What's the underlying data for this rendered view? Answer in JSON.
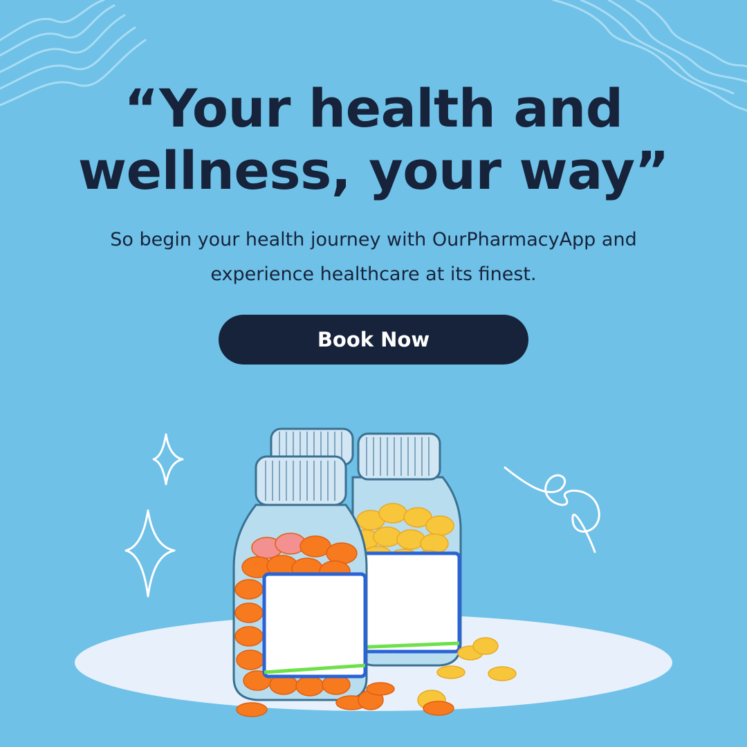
{
  "promo": {
    "headline_line1": "“Your health and",
    "headline_line2": "wellness, your way”",
    "subtext_line1": "So begin your health journey with OurPharmacyApp and",
    "subtext_line2": "experience healthcare at its finest.",
    "cta_label": "Book Now"
  },
  "colors": {
    "background": "#6fc1e8",
    "text": "#17233a",
    "button": "#17233a",
    "button_text": "#ffffff",
    "pill_orange": "#f77a1f",
    "pill_yellow": "#f7c63a",
    "label_border_blue": "#2a63d6",
    "label_border_green": "#6ee04a"
  },
  "icons": [
    "wave-lines-icon",
    "sparkle-icon",
    "squiggle-icon",
    "pill-bottle-icon",
    "pill-icon"
  ]
}
